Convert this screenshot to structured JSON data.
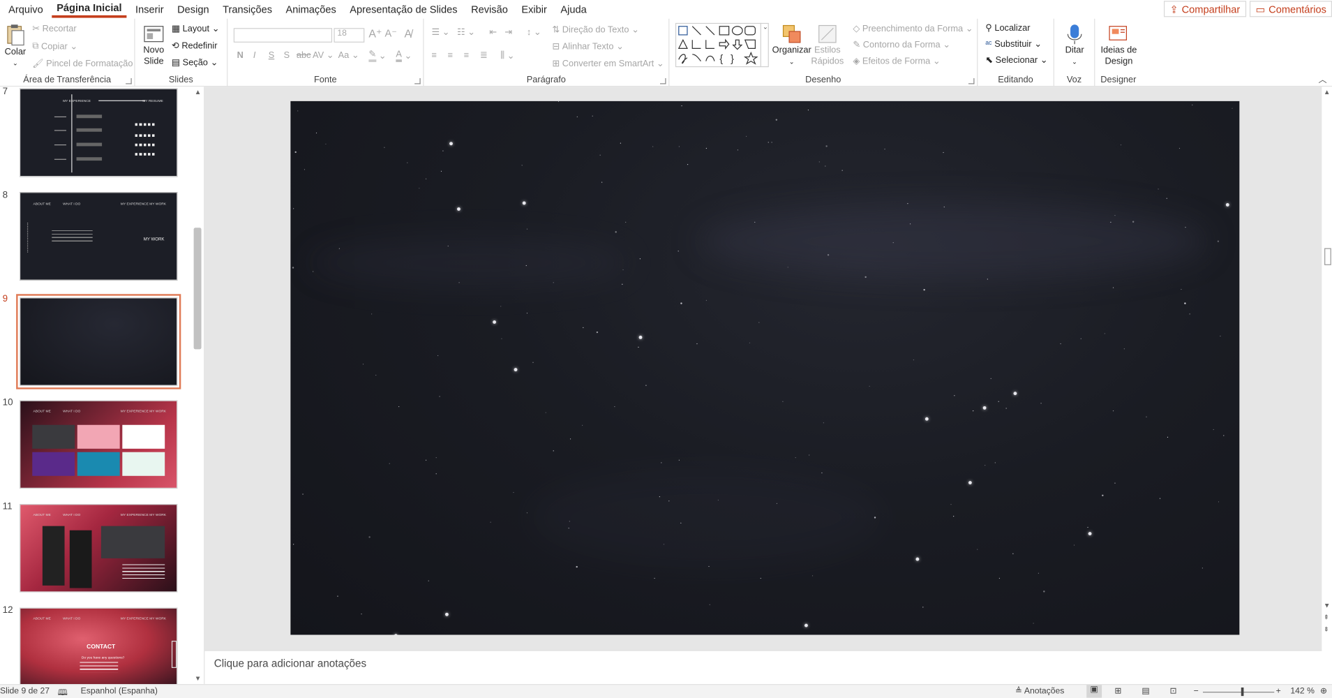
{
  "menu": {
    "items": [
      "Arquivo",
      "Página Inicial",
      "Inserir",
      "Design",
      "Transições",
      "Animações",
      "Apresentação de Slides",
      "Revisão",
      "Exibir",
      "Ajuda"
    ],
    "active_index": 1,
    "share_label": "Compartilhar",
    "comments_label": "Comentários"
  },
  "ribbon": {
    "clipboard": {
      "paste": "Colar",
      "cut": "Recortar",
      "copy": "Copiar",
      "format_painter": "Pincel de Formatação",
      "label": "Área de Transferência"
    },
    "slides": {
      "new_slide_line1": "Novo",
      "new_slide_line2": "Slide",
      "layout": "Layout",
      "reset": "Redefinir",
      "section": "Seção",
      "label": "Slides"
    },
    "font": {
      "font_size": "18",
      "label": "Fonte",
      "bold": "N",
      "italic": "I",
      "underline": "S",
      "shadow": "S",
      "strike": "abc",
      "spacing": "AV",
      "case": "Aa"
    },
    "paragraph": {
      "text_direction": "Direção do Texto",
      "align_text": "Alinhar Texto",
      "smartart": "Converter em SmartArt",
      "label": "Parágrafo"
    },
    "drawing": {
      "arrange": "Organizar",
      "quick_styles_line1": "Estilos",
      "quick_styles_line2": "Rápidos",
      "shape_fill": "Preenchimento da Forma",
      "shape_outline": "Contorno da Forma",
      "shape_effects": "Efeitos de Forma",
      "label": "Desenho"
    },
    "editing": {
      "find": "Localizar",
      "replace": "Substituir",
      "select": "Selecionar",
      "label": "Editando"
    },
    "voice": {
      "dictate": "Ditar",
      "label": "Voz"
    },
    "designer": {
      "ideas_line1": "Ideias de",
      "ideas_line2": "Design",
      "label": "Designer"
    }
  },
  "thumbnails": [
    {
      "number": "7",
      "selected": false,
      "headings": [
        "MY EXPERIENCE",
        "MY RESUME"
      ]
    },
    {
      "number": "8",
      "selected": false,
      "headings": [
        "ABOUT ME",
        "WHAT I DO",
        "MY EXPERIENCE",
        "MY WORK"
      ],
      "title": "MY WORK"
    },
    {
      "number": "9",
      "selected": true
    },
    {
      "number": "10",
      "selected": false,
      "headings": [
        "ABOUT ME",
        "WHAT I DO",
        "MY EXPERIENCE",
        "MY WORK"
      ]
    },
    {
      "number": "11",
      "selected": false,
      "headings": [
        "ABOUT ME",
        "WHAT I DO",
        "MY EXPERIENCE",
        "MY WORK"
      ]
    },
    {
      "number": "12",
      "selected": false,
      "headings": [
        "ABOUT ME",
        "WHAT I DO",
        "MY EXPERIENCE",
        "MY WORK"
      ],
      "title": "CONTACT",
      "subtitle": "Do you have any questions?"
    }
  ],
  "notes_placeholder": "Clique para adicionar anotações",
  "status": {
    "slide_info": "Slide 9 de 27",
    "language": "Espanhol (Espanha)",
    "notes_label": "Anotações",
    "zoom": "142 %"
  },
  "colors": {
    "accent": "#c43e1c",
    "slide_bg": "#1a1c23"
  }
}
